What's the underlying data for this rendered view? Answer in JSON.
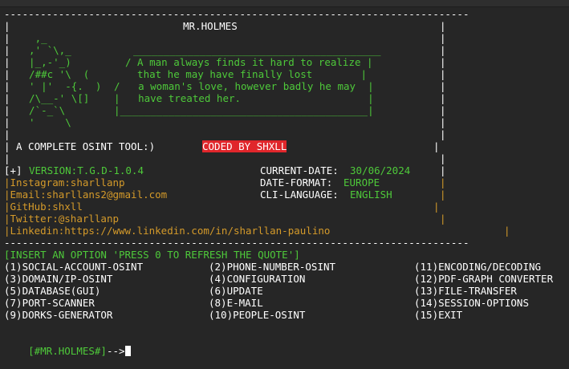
{
  "banner": {
    "rule": "-----------------------------------------------------------------------------",
    "title": "MR.HOLMES",
    "art": [
      "   ,_          ",
      "  ,' `\\,_      ",
      "  |_,-'_)      ",
      "  /##c '\\  (   ",
      "  ' |'  -{.  ) ",
      "  /\\__-' \\[]   ",
      "  /`-_`\\       ",
      "  '     \\      "
    ],
    "quote_top_rule": "_________________________________________",
    "quote_lines": [
      "/ A man always finds it hard to realize |",
      "  that he may have finally lost        |",
      "/   a woman's love, however badly he may  |",
      "|   have treated her.                     |"
    ],
    "quote_bottom_rule": "|_________________________________________|",
    "tool_label": "A COMPLETE OSINT TOOL:)",
    "coded_by": "CODED BY SHXLL"
  },
  "info": {
    "left": [
      {
        "prefix": "[+]",
        "text": "VERSION:T.G.D-1.0.4"
      },
      {
        "prefix": "",
        "text": "Instagram:sharllanp"
      },
      {
        "prefix": "",
        "text": "Email:sharllans2@gmail.com"
      },
      {
        "prefix": "",
        "text": "GitHub:shxll"
      },
      {
        "prefix": "",
        "text": "Twitter:@sharllanp"
      },
      {
        "prefix": "",
        "text": "Linkedin:https://www.linkedin.com/in/sharllan-paulino"
      }
    ],
    "current_date_label": "CURRENT-DATE:",
    "current_date_value": "30/06/2024",
    "date_format_label": "DATE-FORMAT:",
    "date_format_value": "EUROPE",
    "cli_language_label": "CLI-LANGUAGE:",
    "cli_language_value": "ENGLISH"
  },
  "prompt_text": "[INSERT AN OPTION 'PRESS 0 TO REFRESH THE QUOTE']",
  "menu": {
    "col1": [
      "(1)SOCIAL-ACCOUNT-OSINT",
      "(3)DOMAIN/IP-OSINT",
      "(5)DATABASE(GUI)",
      "(7)PORT-SCANNER",
      "(9)DORKS-GENERATOR"
    ],
    "col2": [
      "(2)PHONE-NUMBER-OSINT",
      "(4)CONFIGURATION",
      "(6)UPDATE",
      "(8)E-MAIL",
      "(10)PEOPLE-OSINT"
    ],
    "col3": [
      "(11)ENCODING/DECODING",
      "(12)PDF-GRAPH CONVERTER",
      "(13)FILE-TRANSFER",
      "(14)SESSION-OPTIONS",
      "(15)EXIT"
    ]
  },
  "shell_prompt": "[#MR.HOLMES#]",
  "shell_arrow": "-->",
  "colors": {
    "background": "#262626",
    "green": "#4ec93a",
    "orange": "#d49a2a",
    "badge_red": "#e0262b"
  }
}
